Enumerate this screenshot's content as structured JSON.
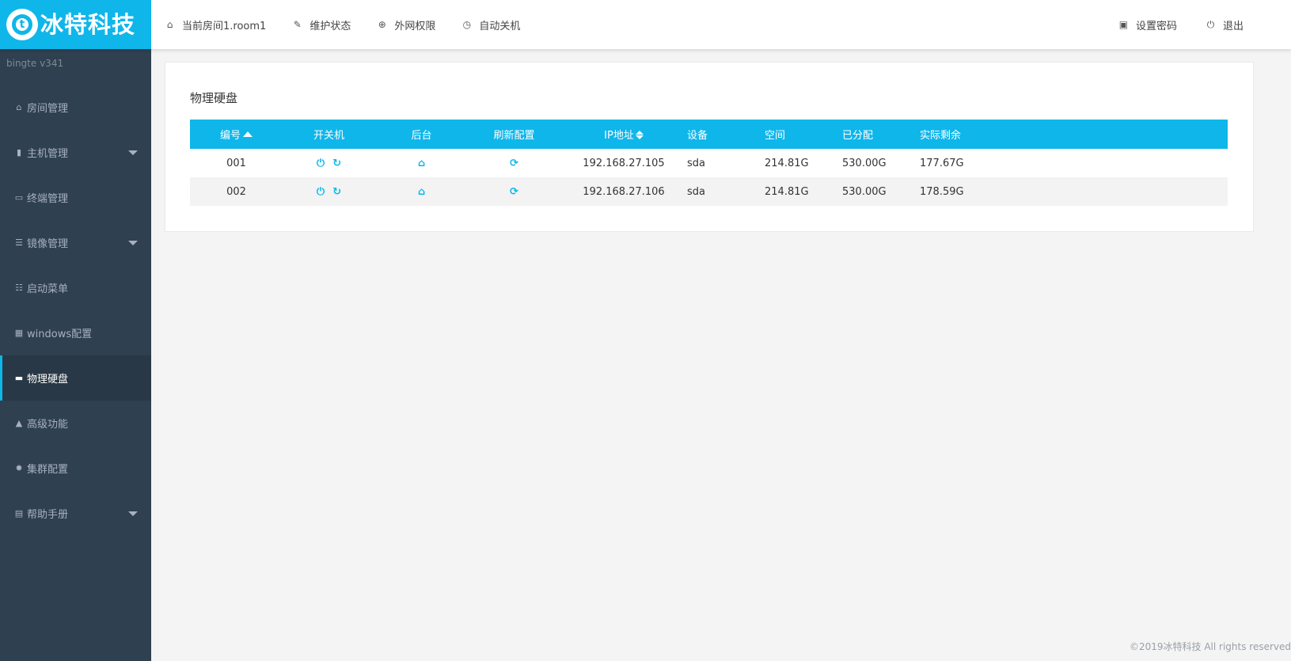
{
  "brand": {
    "name": "冰特科技",
    "mark": "t",
    "color": "#0fb6ea"
  },
  "topnav": [
    {
      "icon": "home-icon",
      "glyph": "⌂",
      "label": "当前房间1.room1"
    },
    {
      "icon": "wrench-icon",
      "glyph": "✎",
      "label": "维护状态"
    },
    {
      "icon": "globe-icon",
      "glyph": "⊕",
      "label": "外网权限"
    },
    {
      "icon": "clock-icon",
      "glyph": "◷",
      "label": "自动关机"
    }
  ],
  "topright": [
    {
      "icon": "lock-icon",
      "glyph": "▣",
      "label": "设置密码"
    },
    {
      "icon": "power-icon",
      "glyph": "⏻",
      "label": "退出"
    }
  ],
  "sidebar": {
    "version": "bingte  v341",
    "items": [
      {
        "icon": "home-icon",
        "glyph": "⌂",
        "label": "房间管理",
        "has_submenu": false
      },
      {
        "icon": "server-icon",
        "glyph": "▮",
        "label": "主机管理",
        "has_submenu": true
      },
      {
        "icon": "monitor-icon",
        "glyph": "▭",
        "label": "终端管理",
        "has_submenu": false
      },
      {
        "icon": "database-icon",
        "glyph": "☰",
        "label": "镜像管理",
        "has_submenu": true
      },
      {
        "icon": "list-icon",
        "glyph": "☷",
        "label": "启动菜单",
        "has_submenu": false
      },
      {
        "icon": "windows-icon",
        "glyph": "▦",
        "label": "windows配置",
        "has_submenu": false
      },
      {
        "icon": "hdd-icon",
        "glyph": "▬",
        "label": "物理硬盘",
        "has_submenu": false,
        "active": true
      },
      {
        "icon": "warning-icon",
        "glyph": "▲",
        "label": "高级功能",
        "has_submenu": false
      },
      {
        "icon": "cog-icon",
        "glyph": "✹",
        "label": "集群配置",
        "has_submenu": false
      },
      {
        "icon": "book-icon",
        "glyph": "▤",
        "label": "帮助手册",
        "has_submenu": true
      }
    ]
  },
  "main": {
    "title": "物理硬盘",
    "table": {
      "headers": [
        "编号",
        "开关机",
        "后台",
        "刷新配置",
        "IP地址",
        "设备",
        "空间",
        "已分配",
        "实际剩余"
      ],
      "rows": [
        {
          "id": "001",
          "ip": "192.168.27.105",
          "device": "sda",
          "space": "214.81G",
          "allocated": "530.00G",
          "remaining": "177.67G"
        },
        {
          "id": "002",
          "ip": "192.168.27.106",
          "device": "sda",
          "space": "214.81G",
          "allocated": "530.00G",
          "remaining": "178.59G"
        }
      ]
    }
  },
  "footer": "©2019冰特科技 All rights reserved"
}
